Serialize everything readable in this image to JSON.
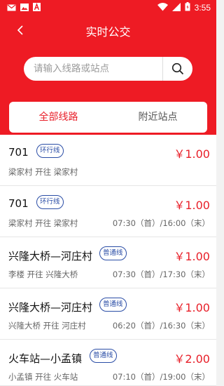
{
  "status_bar": {
    "time": "3:55",
    "left_icons": [
      "mail-icon",
      "image-icon",
      "a-icon"
    ],
    "right_icons": [
      "wifi-icon",
      "signal-icon",
      "battery-icon"
    ]
  },
  "header": {
    "title": "实时公交",
    "back_icon": "chevron-left-icon"
  },
  "search": {
    "placeholder": "请输入线路或站点",
    "value": "",
    "icon": "search-icon"
  },
  "tabs": [
    {
      "label": "全部线路",
      "active": true
    },
    {
      "label": "附近站点",
      "active": false
    }
  ],
  "routes": [
    {
      "name": "701",
      "type": "环行线",
      "fare": "￥1.00",
      "stops": "梁家村 开往 梁家村",
      "hours": ""
    },
    {
      "name": "701",
      "type": "环行线",
      "fare": "￥1.00",
      "stops": "梁家村 开往 梁家村",
      "hours": "07:30（首）/16:00（末）"
    },
    {
      "name": "兴隆大桥—河庄村",
      "type": "普通线",
      "fare": "￥1.00",
      "stops": "李楼 开往 兴隆大桥",
      "hours": "07:30（首）/17:30（末）"
    },
    {
      "name": "兴隆大桥—河庄村",
      "type": "普通线",
      "fare": "￥1.00",
      "stops": "兴隆大桥 开往 河庄村",
      "hours": "06:20（首）/16:30（末）"
    },
    {
      "name": "火车站—小孟镇",
      "type": "普通线",
      "fare": "￥2.00",
      "stops": "小孟镇 开往 火车站",
      "hours": "07:10（首）/19:00（末）"
    }
  ],
  "colors": {
    "brand_red": "#ee1b24",
    "fare_red": "#e8202a",
    "badge_blue": "#2a4da6"
  }
}
